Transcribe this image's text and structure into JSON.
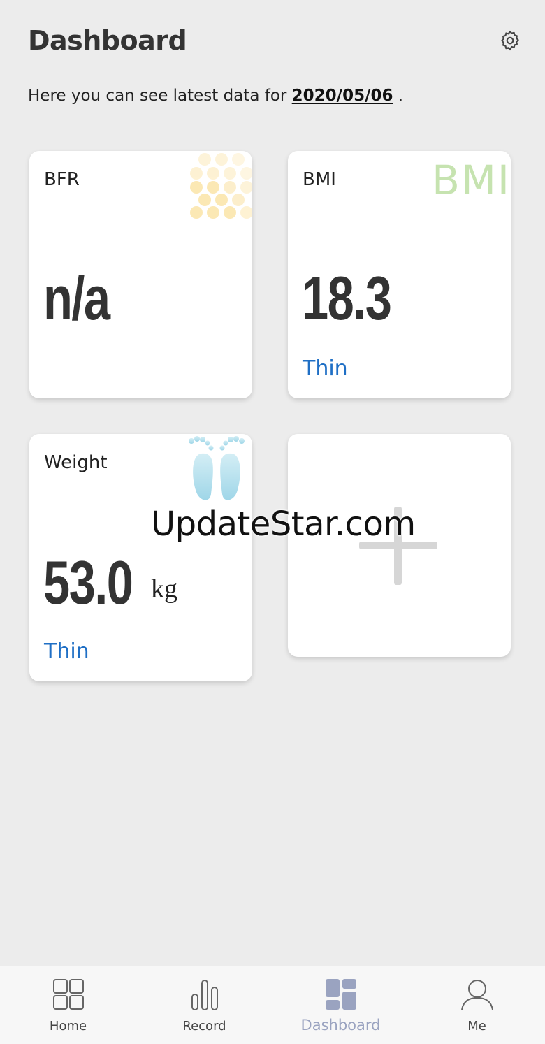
{
  "header": {
    "title": "Dashboard"
  },
  "subtitle": {
    "prefix": "Here you can see latest data for ",
    "date": "2020/05/06",
    "suffix": " ."
  },
  "cards": {
    "bfr": {
      "label": "BFR",
      "value": "n/a"
    },
    "bmi": {
      "label": "BMI",
      "value": "18.3",
      "status": "Thin",
      "decoration": "BMI"
    },
    "weight": {
      "label": "Weight",
      "value": "53.0",
      "unit": "kg",
      "status": "Thin"
    },
    "add": {
      "icon": "plus-icon"
    }
  },
  "watermark": "UpdateStar.com",
  "nav": {
    "items": [
      {
        "label": "Home",
        "icon": "home-grid-icon"
      },
      {
        "label": "Record",
        "icon": "bar-chart-icon"
      },
      {
        "label": "Dashboard",
        "icon": "dashboard-icon",
        "active": true
      },
      {
        "label": "Me",
        "icon": "person-icon"
      }
    ]
  },
  "colors": {
    "accent": "#1f6fc5",
    "active_nav": "#9aa3c0",
    "background": "#ececec"
  }
}
